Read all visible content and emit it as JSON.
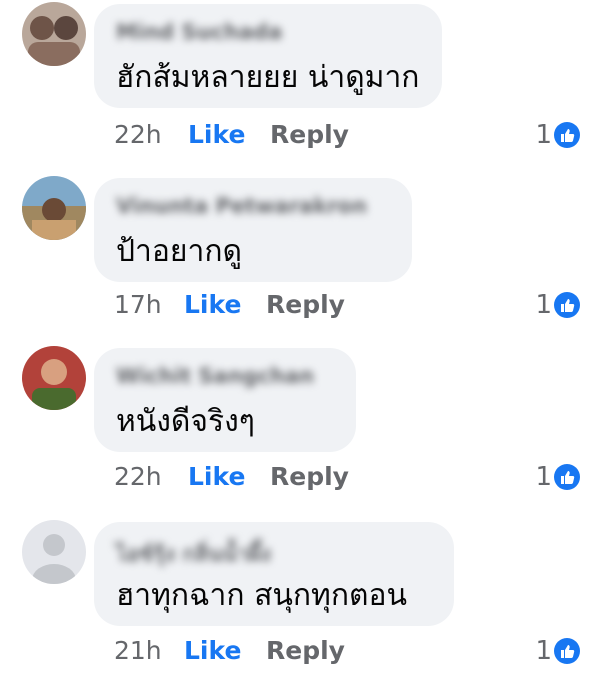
{
  "comments": [
    {
      "author": "Mind Suchada",
      "text": "ฮักส้มหลายยย น่าดูมาก",
      "time": "22h",
      "like_label": "Like",
      "reply_label": "Reply",
      "reaction_count": "1",
      "reaction_icon": "thumbs-up-icon",
      "avatar_color": "#8a6d5f"
    },
    {
      "author": "Vinunta Petwarakron",
      "text": "ป้าอยากดู",
      "time": "17h",
      "like_label": "Like",
      "reply_label": "Reply",
      "reaction_count": "1",
      "reaction_icon": "thumbs-up-icon",
      "avatar_color": "#7a6a4e"
    },
    {
      "author": "Wichit Sangchan",
      "text": "หนังดีจริงๆ",
      "time": "22h",
      "like_label": "Like",
      "reply_label": "Reply",
      "reaction_count": "1",
      "reaction_icon": "thumbs-up-icon",
      "avatar_color": "#9b2f2a"
    },
    {
      "author": "ไอซ์รุ้ง กลิ่นน้ำผึ้ง",
      "text": "ฮาทุกฉาก สนุกทุกตอน",
      "time": "21h",
      "like_label": "Like",
      "reply_label": "Reply",
      "reaction_count": "1",
      "reaction_icon": "thumbs-up-icon",
      "avatar_color": "#d9dbe0"
    }
  ],
  "colors": {
    "accent": "#1877f2",
    "bubble": "#f0f2f5",
    "secondary_text": "#65676b",
    "primary_text": "#050505"
  }
}
